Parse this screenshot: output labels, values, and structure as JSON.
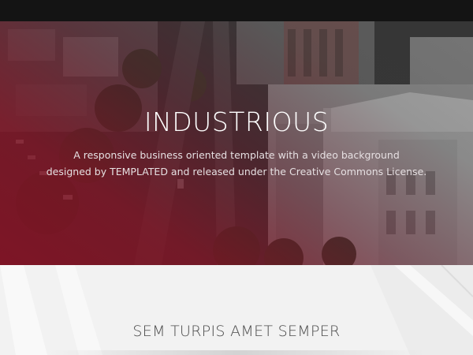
{
  "hero": {
    "title": "INDUSTRIOUS",
    "subtitle_line1": "A responsive business oriented template with a video background",
    "subtitle_line2": "designed by TEMPLATED and released under the Creative Commons License."
  },
  "section": {
    "heading": "SEM TURPIS AMET SEMPER"
  },
  "colors": {
    "topbar": "#141414",
    "overlay_red": "#841224",
    "section_bg": "#f2f2f2",
    "heading_text": "#4a4a4a"
  }
}
